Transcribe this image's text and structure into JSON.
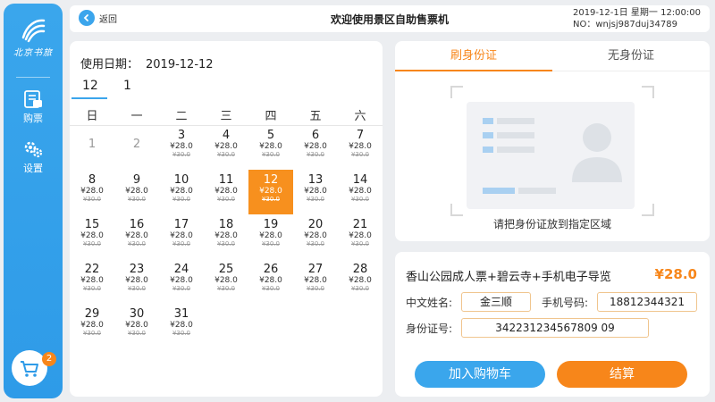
{
  "sidebar": {
    "logo_text": "北京书旅",
    "nav": [
      {
        "label": "购票",
        "icon": "ticket-icon"
      },
      {
        "label": "设置",
        "icon": "gear-icon"
      }
    ],
    "cart_count": "2"
  },
  "header": {
    "back_label": "返回",
    "title": "欢迎使用景区自助售票机",
    "datetime": "2019-12-1日 星期一 12:00:00",
    "machine_no": "NO：wnjsj987duj34789"
  },
  "calendar": {
    "usage_label": "使用日期：",
    "usage_value": "2019-12-12",
    "months": [
      "12",
      "1"
    ],
    "weekdays": [
      "日",
      "一",
      "二",
      "三",
      "四",
      "五",
      "六"
    ],
    "price": "¥28.0",
    "old_price": "¥30.0",
    "days": [
      {
        "d": "1",
        "w": 1,
        "r": 0,
        "priced": false
      },
      {
        "d": "2",
        "w": 2,
        "r": 0,
        "priced": false
      },
      {
        "d": "3",
        "w": 3,
        "r": 0,
        "priced": true
      },
      {
        "d": "4",
        "w": 4,
        "r": 0,
        "priced": true
      },
      {
        "d": "5",
        "w": 5,
        "r": 0,
        "priced": true
      },
      {
        "d": "6",
        "w": 6,
        "r": 0,
        "priced": true
      },
      {
        "d": "7",
        "w": 7,
        "r": 0,
        "priced": true
      },
      {
        "d": "8",
        "w": 1,
        "r": 1,
        "priced": true
      },
      {
        "d": "9",
        "w": 2,
        "r": 1,
        "priced": true
      },
      {
        "d": "10",
        "w": 3,
        "r": 1,
        "priced": true
      },
      {
        "d": "11",
        "w": 4,
        "r": 1,
        "priced": true
      },
      {
        "d": "12",
        "w": 5,
        "r": 1,
        "priced": true,
        "selected": true
      },
      {
        "d": "13",
        "w": 6,
        "r": 1,
        "priced": true
      },
      {
        "d": "14",
        "w": 7,
        "r": 1,
        "priced": true
      },
      {
        "d": "15",
        "w": 1,
        "r": 2,
        "priced": true
      },
      {
        "d": "16",
        "w": 2,
        "r": 2,
        "priced": true
      },
      {
        "d": "17",
        "w": 3,
        "r": 2,
        "priced": true
      },
      {
        "d": "18",
        "w": 4,
        "r": 2,
        "priced": true
      },
      {
        "d": "19",
        "w": 5,
        "r": 2,
        "priced": true
      },
      {
        "d": "20",
        "w": 6,
        "r": 2,
        "priced": true
      },
      {
        "d": "21",
        "w": 7,
        "r": 2,
        "priced": true
      },
      {
        "d": "22",
        "w": 1,
        "r": 3,
        "priced": true
      },
      {
        "d": "23",
        "w": 2,
        "r": 3,
        "priced": true
      },
      {
        "d": "24",
        "w": 3,
        "r": 3,
        "priced": true
      },
      {
        "d": "25",
        "w": 4,
        "r": 3,
        "priced": true
      },
      {
        "d": "26",
        "w": 5,
        "r": 3,
        "priced": true
      },
      {
        "d": "27",
        "w": 6,
        "r": 3,
        "priced": true
      },
      {
        "d": "28",
        "w": 7,
        "r": 3,
        "priced": true
      },
      {
        "d": "29",
        "w": 1,
        "r": 4,
        "priced": true
      },
      {
        "d": "30",
        "w": 2,
        "r": 4,
        "priced": true
      },
      {
        "d": "31",
        "w": 3,
        "r": 4,
        "priced": true
      }
    ]
  },
  "id_panel": {
    "tabs": [
      "刷身份证",
      "无身份证"
    ],
    "hint": "请把身份证放到指定区域"
  },
  "order": {
    "product": "香山公园成人票+碧云寺+手机电子导览",
    "price": "¥28.0",
    "name_label": "中文姓名:",
    "name_value": "金三顺",
    "phone_label": "手机号码:",
    "phone_value": "18812344321",
    "id_label": "身份证号:",
    "id_value": "342231234567809 09",
    "add_cart": "加入购物车",
    "checkout": "结算"
  },
  "colors": {
    "accent_blue": "#3aa6ec",
    "accent_orange": "#f7861a"
  }
}
